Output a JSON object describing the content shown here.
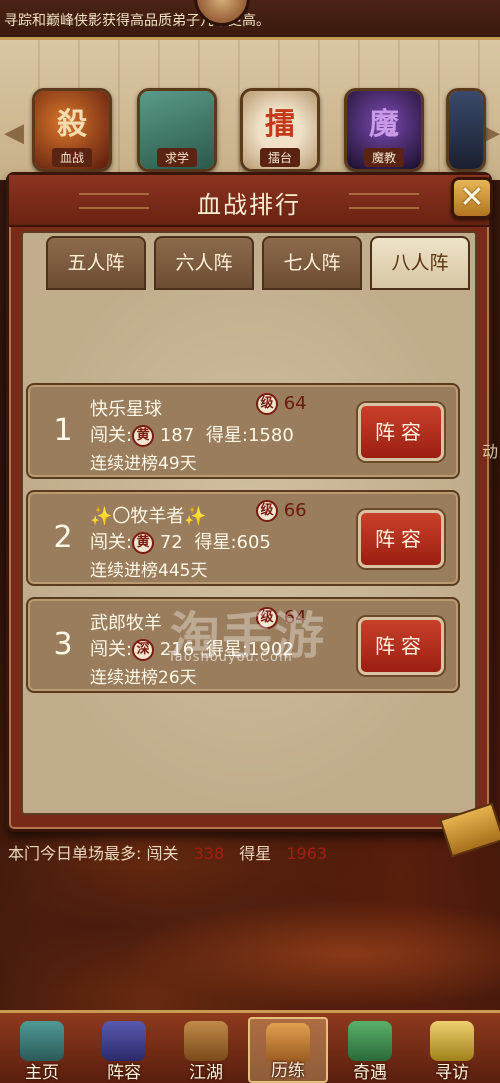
{
  "notice": "寻踪和巅峰侠影获得高品质弟子几率更高。",
  "events": [
    {
      "label": "血战",
      "glyph": "殺",
      "color": "#8a1a0e"
    },
    {
      "label": "求学",
      "glyph": "",
      "color": "#2c6a5a"
    },
    {
      "label": "擂台",
      "glyph": "擂",
      "color": "#b23a1a"
    },
    {
      "label": "魔教",
      "glyph": "魔",
      "color": "#3a2454"
    }
  ],
  "panel": {
    "title": "血战排行",
    "tabs": [
      "五人阵",
      "六人阵",
      "七人阵",
      "八人阵"
    ],
    "active_tab": 3,
    "rows": [
      {
        "rank": "1",
        "name": "快乐星球",
        "level_seal": "级",
        "level": "64",
        "stage_label": "闯关:",
        "tier_seal": "黄",
        "stage": "187",
        "star_label": "得星:",
        "stars": "1580",
        "streak": "连续进榜49天",
        "button": "阵容"
      },
      {
        "rank": "2",
        "name": "〇牧羊者",
        "name_prefix": "✨",
        "name_suffix": "✨",
        "level_seal": "级",
        "level": "66",
        "stage_label": "闯关:",
        "tier_seal": "黄",
        "stage": "72",
        "star_label": "得星:",
        "stars": "605",
        "streak": "连续进榜445天",
        "button": "阵容"
      },
      {
        "rank": "3",
        "name": "武郎牧羊",
        "level_seal": "级",
        "level": "64",
        "stage_label": "闯关:",
        "tier_seal": "深",
        "stage": "216",
        "star_label": "得星:",
        "stars": "1902",
        "streak": "连续进榜26天",
        "button": "阵容"
      }
    ]
  },
  "watermark": {
    "text": "淘手游",
    "url": "Taoshouyou.Com"
  },
  "summary": {
    "label": "本门今日单场最多:",
    "stage_label": "闯关",
    "stage_value": "338",
    "star_label": "得星",
    "star_value": "1963"
  },
  "side_text": "动",
  "nav": [
    {
      "label": "主页",
      "icon": "home-icon",
      "color": "#3e7d7a"
    },
    {
      "label": "阵容",
      "icon": "lineup-icon",
      "color": "#3a3a8a"
    },
    {
      "label": "江湖",
      "icon": "jianghu-icon",
      "color": "#a06a30"
    },
    {
      "label": "历练",
      "icon": "training-icon",
      "color": "#c08040"
    },
    {
      "label": "奇遇",
      "icon": "adventure-icon",
      "color": "#3c8a4a"
    },
    {
      "label": "寻访",
      "icon": "visit-icon",
      "color": "#d8b44a"
    }
  ],
  "colors": {
    "accent_red": "#a21d14",
    "panel": "#7a2a18",
    "parchment": "#c1ad8c"
  }
}
